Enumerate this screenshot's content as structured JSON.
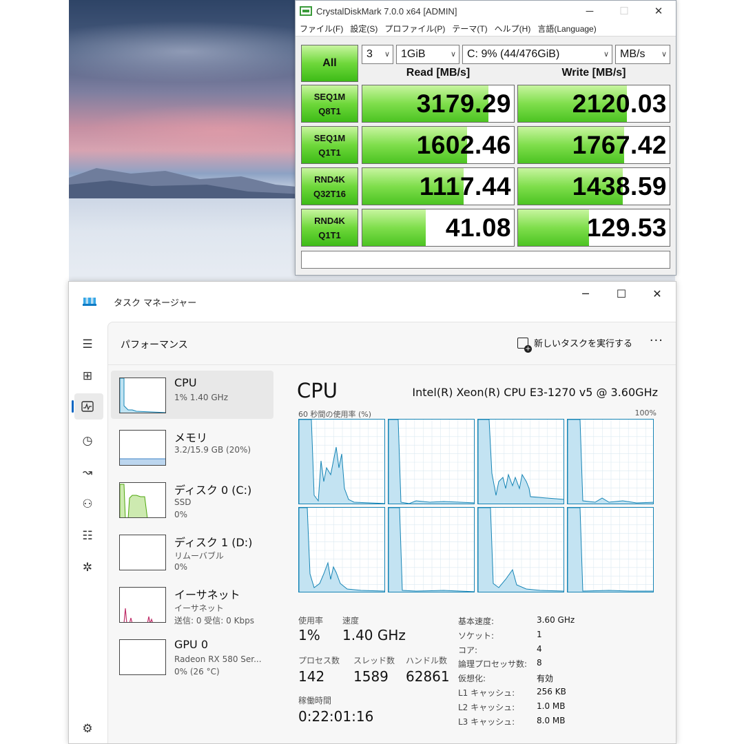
{
  "cdm": {
    "title": "CrystalDiskMark 7.0.0 x64 [ADMIN]",
    "menu": [
      "ファイル(F)",
      "設定(S)",
      "プロファイル(P)",
      "テーマ(T)",
      "ヘルプ(H)",
      "言語(Language)"
    ],
    "all_label": "All",
    "count": "3",
    "size": "1GiB",
    "drive": "C: 9% (44/476GiB)",
    "unit": "MB/s",
    "read_header": "Read [MB/s]",
    "write_header": "Write [MB/s]",
    "rows": [
      {
        "l1": "SEQ1M",
        "l2": "Q8T1",
        "read": "3179.29",
        "write": "2120.03",
        "read_fill": 0.83,
        "write_fill": 0.72
      },
      {
        "l1": "SEQ1M",
        "l2": "Q1T1",
        "read": "1602.46",
        "write": "1767.42",
        "read_fill": 0.69,
        "write_fill": 0.7
      },
      {
        "l1": "RND4K",
        "l2": "Q32T16",
        "read": "1117.44",
        "write": "1438.59",
        "read_fill": 0.67,
        "write_fill": 0.69
      },
      {
        "l1": "RND4K",
        "l2": "Q1T1",
        "read": "41.08",
        "write": "129.53",
        "read_fill": 0.42,
        "write_fill": 0.47
      }
    ],
    "accent": "#4cc422"
  },
  "tm": {
    "title": "タスク マネージャー",
    "page_title": "パフォーマンス",
    "run_task": "新しいタスクを実行する",
    "resources": [
      {
        "name": "CPU",
        "l2": "1% 1.40 GHz",
        "l3": ""
      },
      {
        "name": "メモリ",
        "l2": "3.2/15.9 GB (20%)",
        "l3": ""
      },
      {
        "name": "ディスク 0 (C:)",
        "l2": "SSD",
        "l3": "0%"
      },
      {
        "name": "ディスク 1 (D:)",
        "l2": "リムーバブル",
        "l3": "0%"
      },
      {
        "name": "イーサネット",
        "l2": "イーサネット",
        "l3": "送信: 0 受信: 0 Kbps"
      },
      {
        "name": "GPU 0",
        "l2": "Radeon RX 580 Ser...",
        "l3": "0% (26 °C)"
      }
    ],
    "cpu": {
      "heading": "CPU",
      "model": "Intel(R) Xeon(R) CPU E3-1270 v5 @ 3.60GHz",
      "axis_left": "60 秒間の使用率 (%)",
      "axis_right": "100%",
      "usage_label": "使用率",
      "usage": "1%",
      "speed_label": "速度",
      "speed": "1.40 GHz",
      "proc_label": "プロセス数",
      "proc": "142",
      "thread_label": "スレッド数",
      "thread": "1589",
      "handle_label": "ハンドル数",
      "handle": "62861",
      "uptime_label": "稼働時間",
      "uptime": "0:22:01:16",
      "specs": [
        {
          "k": "基本速度:",
          "v": "3.60 GHz"
        },
        {
          "k": "ソケット:",
          "v": "1"
        },
        {
          "k": "コア:",
          "v": "4"
        },
        {
          "k": "論理プロセッサ数:",
          "v": "8"
        },
        {
          "k": "仮想化:",
          "v": "有効"
        },
        {
          "k": "L1 キャッシュ:",
          "v": "256 KB"
        },
        {
          "k": "L2 キャッシュ:",
          "v": "1.0 MB"
        },
        {
          "k": "L3 キャッシュ:",
          "v": "8.0 MB"
        }
      ]
    },
    "cpu_color": "#1584b5",
    "disk_color": "#4da60c",
    "net_color": "#c0306a"
  }
}
